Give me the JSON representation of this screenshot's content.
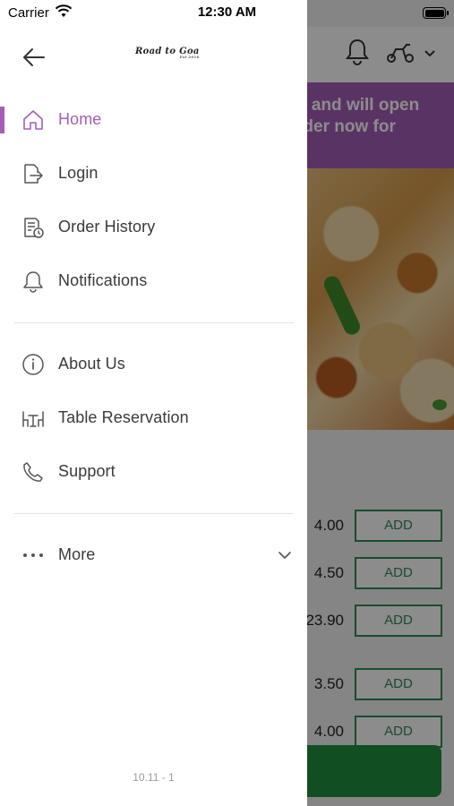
{
  "status_bar": {
    "carrier": "Carrier",
    "time": "12:30 AM"
  },
  "drawer": {
    "logo_text": "Road to Goa",
    "logo_subtext": "Est 2016",
    "primary_items": [
      {
        "label": "Home",
        "icon": "home-icon",
        "active": true
      },
      {
        "label": "Login",
        "icon": "login-icon",
        "active": false
      },
      {
        "label": "Order History",
        "icon": "order-history-icon",
        "active": false
      },
      {
        "label": "Notifications",
        "icon": "bell-icon",
        "active": false
      }
    ],
    "secondary_items": [
      {
        "label": "About Us",
        "icon": "info-icon"
      },
      {
        "label": "Table Reservation",
        "icon": "table-icon"
      },
      {
        "label": "Support",
        "icon": "phone-icon"
      }
    ],
    "more_label": "More",
    "version": "10.11 - 1",
    "accent_color": "#a55db8"
  },
  "background": {
    "banner_lines": [
      "d and will open",
      "rder now for"
    ],
    "menu_rows": [
      {
        "price": "4.00",
        "button": "ADD"
      },
      {
        "price": "4.50",
        "button": "ADD"
      },
      {
        "price": "23.90",
        "button": "ADD"
      },
      {
        "price": "3.50",
        "button": "ADD"
      },
      {
        "price": "4.00",
        "button": "ADD"
      }
    ],
    "add_button_color": "#2e8b57",
    "cart_button_color": "#1f8f3c"
  }
}
